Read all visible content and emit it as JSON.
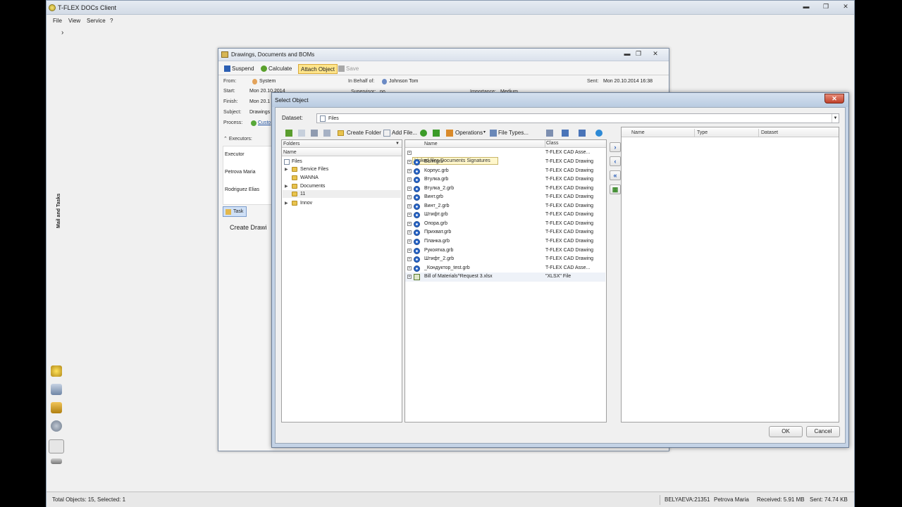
{
  "app": {
    "title": "T-FLEX DOCs Client",
    "window_controls": [
      "▬",
      "❐",
      "✕"
    ],
    "menu": [
      "File",
      "View",
      "Service",
      "?"
    ],
    "expand_glyph": "›",
    "side_label": "Mail and Tasks"
  },
  "task_dialog": {
    "title": "Drawings, Documents and BOMs",
    "toolbar": {
      "suspend": "Suspend",
      "calculate": "Calculate",
      "attach": "Attach Object",
      "save": "Save"
    },
    "fields": {
      "from_label": "From:",
      "from_value": "System",
      "on_behalf_label": "In Behalf of:",
      "on_behalf_value": "Johnson Tom",
      "sent_label": "Sent:",
      "sent_value": "Mon 20.10.2014 16:38",
      "start_label": "Start:",
      "start_value": "Mon 20.10.2014",
      "supervisor_label": "Supervisor:",
      "supervisor_value": "no",
      "importance_label": "Importance:",
      "importance_value": "Medium",
      "finish_label": "Finish:",
      "finish_value": "Mon 20.1",
      "subject_label": "Subject:",
      "subject_value": "Drawings",
      "process_label": "Process:",
      "process_value": "Custo"
    },
    "executors_label": "Executors:",
    "executors": [
      "Executor",
      "Petrova Maria",
      "Rodriguez Elias"
    ],
    "tab_task": "Task",
    "body_text": "Create Drawi"
  },
  "select_dialog": {
    "title": "Select Object",
    "close": "✕",
    "dataset_label": "Dataset:",
    "dataset_value": "Files",
    "toolbar": {
      "create_folder": "Create Folder",
      "add_file": "Add File...",
      "operations": "Operations",
      "file_types": "File Types..."
    },
    "folders_header": "Folders",
    "folders_name_header": "Name",
    "tree": [
      "Files",
      "Service Files",
      "WANNA",
      "Documents",
      "11",
      "Innov"
    ],
    "files_name_header": "Name",
    "files_class_header": "Class",
    "linked_strip": "Linked files  Documents  Signatures",
    "files": [
      {
        "name": "Болт.grb",
        "cls": "T-FLEX CAD Drawing"
      },
      {
        "name": "Корпус.grb",
        "cls": "T-FLEX CAD Drawing"
      },
      {
        "name": "Втулка.grb",
        "cls": "T-FLEX CAD Drawing"
      },
      {
        "name": "Втулка_2.grb",
        "cls": "T-FLEX CAD Drawing"
      },
      {
        "name": "Винт.grb",
        "cls": "T-FLEX CAD Drawing"
      },
      {
        "name": "Винт_2.grb",
        "cls": "T-FLEX CAD Drawing"
      },
      {
        "name": "Штифт.grb",
        "cls": "T-FLEX CAD Drawing"
      },
      {
        "name": "Опора.grb",
        "cls": "T-FLEX CAD Drawing"
      },
      {
        "name": "Прихват.grb",
        "cls": "T-FLEX CAD Drawing"
      },
      {
        "name": "Планка.grb",
        "cls": "T-FLEX CAD Drawing"
      },
      {
        "name": "Рукоятка.grb",
        "cls": "T-FLEX CAD Drawing"
      },
      {
        "name": "Штифт_2.grb",
        "cls": "T-FLEX CAD Drawing"
      },
      {
        "name": "_Кондуктор_test.grb",
        "cls": "T-FLEX CAD Asse..."
      },
      {
        "name": "Bill of Materials^Request 3.xlsx",
        "cls": "\"XLSX\" File"
      }
    ],
    "first_row_class": "T-FLEX CAD Asse...",
    "nav_buttons": [
      "›",
      "‹",
      "«",
      "▦"
    ],
    "right_headers": [
      "Name",
      "Type",
      "Dataset"
    ],
    "ok": "OK",
    "cancel": "Cancel"
  },
  "status": {
    "total": "Total Objects: 15, Selected: 1",
    "host": "BELYAEVA:21351",
    "user": "Petrova Maria",
    "received": "Received: 5.91 MB",
    "sent": "Sent: 74.74 KB"
  }
}
